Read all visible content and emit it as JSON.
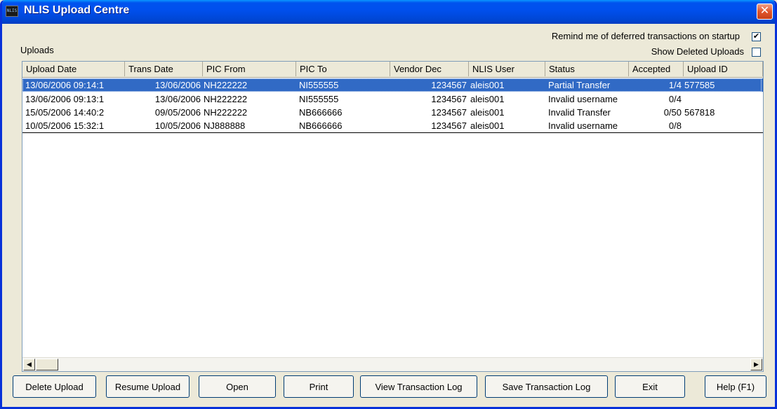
{
  "window": {
    "title": "NLIS Upload Centre",
    "icon": "nlis-app-icon",
    "icon_text": "NLIS",
    "close_glyph": "✕"
  },
  "options": {
    "remind_label": "Remind me of deferred transactions on startup",
    "remind_checked": true,
    "remind_mark": "✔",
    "show_deleted_label": "Show Deleted Uploads",
    "show_deleted_checked": false,
    "show_deleted_mark": ""
  },
  "uploads_label": "Uploads",
  "table": {
    "columns": [
      "Upload Date",
      "Trans Date",
      "PIC From",
      "PIC To",
      "Vendor Dec",
      "NLIS User",
      "Status",
      "Accepted",
      "Upload ID"
    ],
    "rows": [
      [
        "13/06/2006 09:14:1",
        "13/06/2006",
        "NH222222",
        "NI555555",
        "1234567",
        "aleis001",
        "Partial Transfer",
        "1/4",
        "577585"
      ],
      [
        "13/06/2006 09:13:1",
        "13/06/2006",
        "NH222222",
        "NI555555",
        "1234567",
        "aleis001",
        "Invalid username",
        "0/4",
        ""
      ],
      [
        "15/05/2006 14:40:2",
        "09/05/2006",
        "NH222222",
        "NB666666",
        "1234567",
        "aleis001",
        "Invalid Transfer",
        "0/50",
        "567818"
      ],
      [
        "10/05/2006 15:32:1",
        "10/05/2006",
        "NJ888888",
        "NB666666",
        "1234567",
        "aleis001",
        "Invalid username",
        "0/8",
        ""
      ]
    ],
    "selected_row": 0
  },
  "scrollbar": {
    "left_arrow": "◀",
    "right_arrow": "▶"
  },
  "buttons": {
    "delete": "Delete Upload",
    "resume": "Resume Upload",
    "open": "Open",
    "print": "Print",
    "view_log": "View Transaction Log",
    "save_log": "Save Transaction Log",
    "exit": "Exit",
    "help": "Help (F1)"
  },
  "colors": {
    "titlebar": "#0053ee",
    "selection": "#316ac5",
    "close": "#e1552c"
  }
}
